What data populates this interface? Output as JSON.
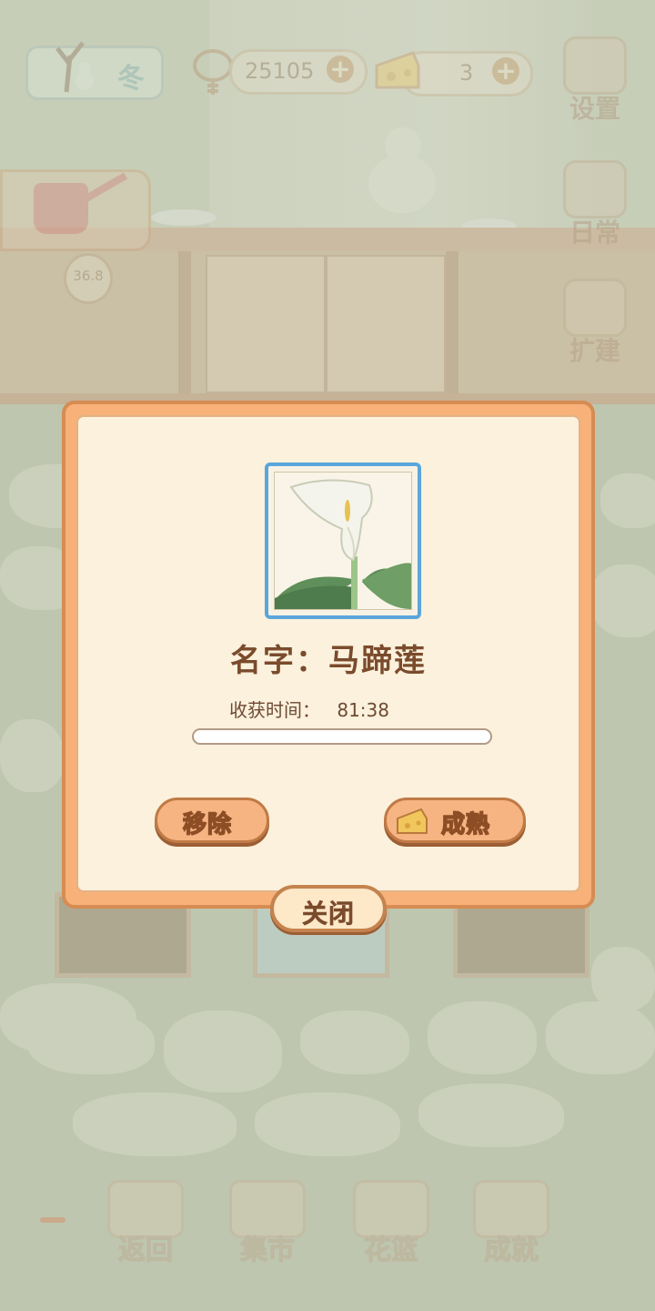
{
  "hud": {
    "season_label": "冬",
    "fish_currency": "25105",
    "cheese_currency": "3",
    "plus_symbol": "+"
  },
  "side_menu": [
    {
      "label": "设置",
      "icon": "gear-icon"
    },
    {
      "label": "日常",
      "icon": "notepad-icon"
    },
    {
      "label": "扩建",
      "icon": "hammer-icon"
    }
  ],
  "watering_timer": "36.8",
  "dialog": {
    "plant_name": "名字：马蹄莲",
    "harvest_label": "收获时间：",
    "harvest_time": "81:38",
    "progress_fraction": 0.0,
    "remove_button": "移除",
    "ripen_button": "成熟",
    "close_button": "关闭"
  },
  "bottom_nav": [
    {
      "label": "返回",
      "icon": "window-icon"
    },
    {
      "label": "集市",
      "icon": "market-stall-icon"
    },
    {
      "label": "花篮",
      "icon": "flower-basket-icon"
    },
    {
      "label": "成就",
      "icon": "trophy-icon"
    }
  ],
  "colors": {
    "dialog_border": "#f7b179",
    "dialog_bg": "#fbf1dc",
    "frame_blue": "#5aa6dc",
    "button_fill": "#f6b482",
    "text_brown": "#7a4b2c"
  }
}
